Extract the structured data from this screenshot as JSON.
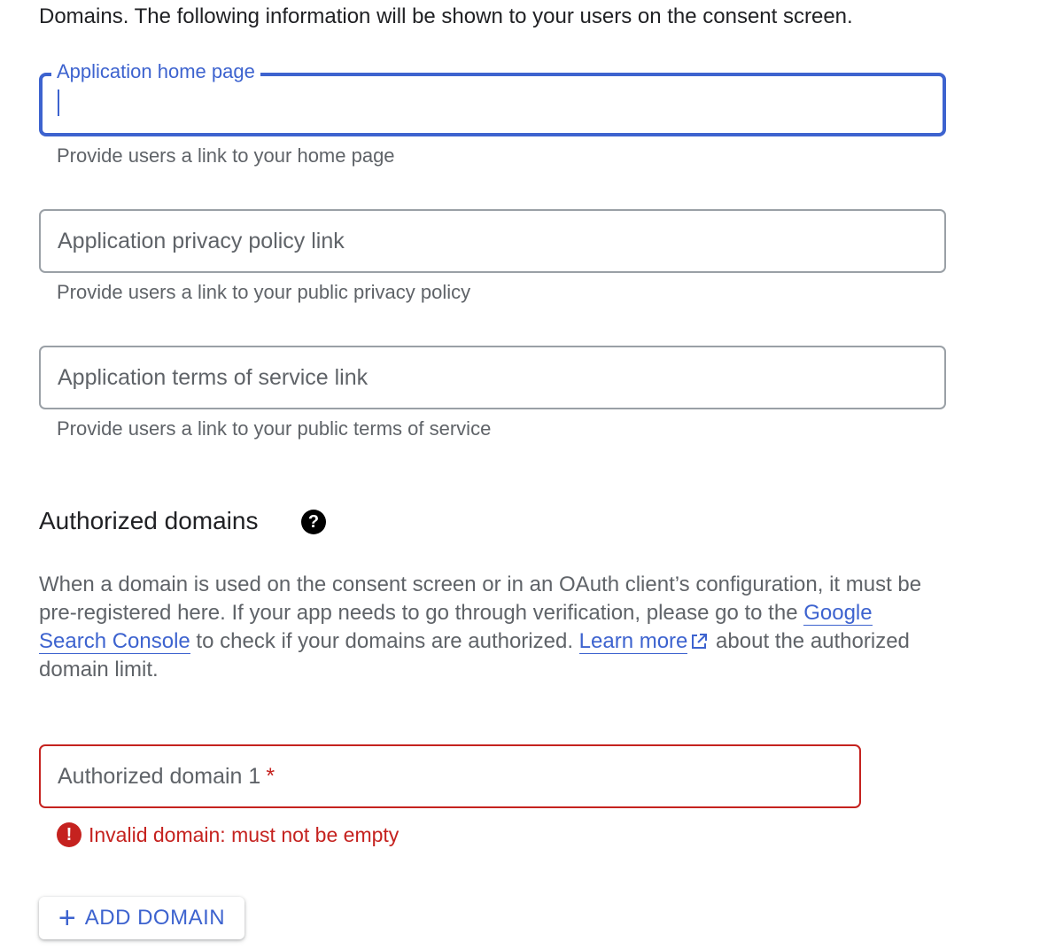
{
  "intro": {
    "text": "Domains. The following information will be shown to your users on the consent screen."
  },
  "fields": {
    "home_page": {
      "label": "Application home page",
      "value": "",
      "helper": "Provide users a link to your home page"
    },
    "privacy_policy": {
      "placeholder": "Application privacy policy link",
      "value": "",
      "helper": "Provide users a link to your public privacy policy"
    },
    "terms_of_service": {
      "placeholder": "Application terms of service link",
      "value": "",
      "helper": "Provide users a link to your public terms of service"
    }
  },
  "authorized_domains": {
    "title": "Authorized domains",
    "help_icon": "help-circle-icon",
    "description": {
      "part1": "When a domain is used on the consent screen or in an OAuth client’s configuration, it must be pre-registered here. If your app needs to go through verification, please go to the ",
      "link1": "Google Search Console",
      "part2": " to check if your domains are authorized. ",
      "link2": "Learn more",
      "part3": " about the authorized domain limit."
    },
    "domain_field": {
      "placeholder": "Authorized domain 1",
      "required_marker": "*",
      "value": ""
    },
    "error": {
      "icon": "error-icon",
      "text": "Invalid domain: must not be empty"
    },
    "add_button": {
      "icon": "plus-icon",
      "label": "ADD DOMAIN"
    }
  },
  "colors": {
    "accent": "#3d63cf",
    "error": "#c5221f",
    "text_secondary": "#5f6368",
    "border": "#9aa0a6"
  }
}
